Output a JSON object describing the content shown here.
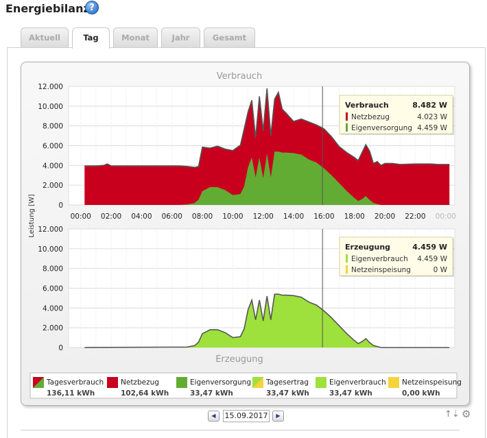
{
  "header": {
    "title": "Energiebilanz",
    "help_icon": "question-mark-icon",
    "help_label": "?"
  },
  "tabs": [
    {
      "label": "Aktuell",
      "active": false
    },
    {
      "label": "Tag",
      "active": true
    },
    {
      "label": "Monat",
      "active": false
    },
    {
      "label": "Jahr",
      "active": false
    },
    {
      "label": "Gesamt",
      "active": false
    }
  ],
  "colors": {
    "netzbezug": "#c8001e",
    "eigenversorgung": "#62ac34",
    "eigenverbrauch": "#9ee03c",
    "netzeinspeisung": "#f5d33a"
  },
  "chart_data": [
    {
      "type": "area",
      "title": "Verbrauch",
      "ylabel": "Leistung [W]",
      "ylim": [
        0,
        12000
      ],
      "yticks": [
        "0",
        "2.000",
        "4.000",
        "6.000",
        "8.000",
        "10.000",
        "12.000"
      ],
      "xlim": [
        0,
        24
      ],
      "xticks": [
        "00:00",
        "02:00",
        "04:00",
        "06:00",
        "08:00",
        "10:00",
        "12:00",
        "14:00",
        "16:00",
        "18:00",
        "20:00",
        "22:00",
        "00:00"
      ],
      "grid": true,
      "x": [
        0.25,
        1,
        1.5,
        1.75,
        2,
        3,
        4,
        5,
        6,
        6.5,
        7,
        7.5,
        7.75,
        8,
        8.5,
        9,
        9.5,
        10,
        10.5,
        10.75,
        11,
        11.25,
        11.5,
        11.75,
        12,
        12.25,
        12.5,
        12.75,
        13,
        13.25,
        13.5,
        14,
        14.5,
        15,
        15.5,
        16,
        16.5,
        17,
        17.5,
        18,
        18.25,
        18.5,
        18.75,
        19,
        19.25,
        19.5,
        19.75,
        20,
        20.5,
        21,
        22,
        23,
        23.5,
        24.25
      ],
      "series": [
        {
          "name": "Netzbezug",
          "stack": "load",
          "values": [
            3950,
            3950,
            4000,
            4150,
            3950,
            3950,
            3950,
            3950,
            3950,
            3950,
            3850,
            3600,
            3350,
            4450,
            3950,
            4150,
            4150,
            4500,
            4950,
            5800,
            5600,
            5800,
            4000,
            6200,
            4800,
            6600,
            4200,
            5300,
            6000,
            4400,
            4000,
            3200,
            3600,
            3800,
            3800,
            4000,
            3900,
            3700,
            3900,
            4100,
            4100,
            4700,
            5200,
            4950,
            4000,
            4300,
            4000,
            4200,
            4200,
            4100,
            4150,
            4150,
            4100,
            4100
          ]
        },
        {
          "name": "Eigenversorgung",
          "stack": "load",
          "values": [
            0,
            0,
            0,
            0,
            0,
            0,
            0,
            0,
            0,
            0,
            50,
            200,
            550,
            1400,
            1800,
            1800,
            1500,
            1000,
            1100,
            1900,
            3800,
            4800,
            2800,
            4800,
            2700,
            5200,
            2800,
            5400,
            5400,
            5300,
            5300,
            5250,
            5100,
            4600,
            4300,
            3700,
            3000,
            2200,
            1400,
            700,
            400,
            600,
            900,
            500,
            200,
            100,
            0,
            0,
            0,
            0,
            0,
            0,
            0,
            0
          ]
        }
      ],
      "tooltip": {
        "time": 15.9,
        "title": "Verbrauch",
        "total": "8.482 W",
        "rows": [
          {
            "label": "Netzbezug",
            "value": "4.023 W"
          },
          {
            "label": "Eigenversorgung",
            "value": "4.459 W"
          }
        ]
      }
    },
    {
      "type": "area",
      "title": "Erzeugung",
      "ylabel": "Leistung [W]",
      "ylim": [
        0,
        12000
      ],
      "yticks": [
        "0",
        "2.000",
        "4.000",
        "6.000",
        "8.000",
        "10.000",
        "12.000"
      ],
      "xlim": [
        0,
        24
      ],
      "grid": true,
      "x": [
        0.25,
        7,
        7.5,
        7.75,
        8,
        8.5,
        9,
        9.5,
        10,
        10.5,
        10.75,
        11,
        11.25,
        11.5,
        11.75,
        12,
        12.25,
        12.5,
        12.75,
        13,
        13.25,
        13.5,
        14,
        14.5,
        15,
        15.5,
        16,
        16.5,
        17,
        17.5,
        18,
        18.25,
        18.5,
        18.75,
        19,
        19.25,
        19.5,
        19.75,
        20,
        24.25
      ],
      "series": [
        {
          "name": "Eigenverbrauch",
          "values": [
            0,
            50,
            200,
            550,
            1400,
            1800,
            1800,
            1500,
            1000,
            1100,
            1900,
            3800,
            4800,
            2800,
            4800,
            2700,
            5200,
            2800,
            5400,
            5400,
            5300,
            5300,
            5250,
            5100,
            4600,
            4300,
            3700,
            3000,
            2200,
            1400,
            700,
            400,
            600,
            900,
            500,
            200,
            100,
            0,
            0,
            0
          ]
        },
        {
          "name": "Netzeinspeisung",
          "values": [
            0,
            0,
            0,
            0,
            0,
            0,
            0,
            0,
            0,
            0,
            0,
            0,
            0,
            0,
            0,
            0,
            0,
            0,
            0,
            0,
            0,
            0,
            0,
            0,
            0,
            0,
            0,
            0,
            0,
            0,
            0,
            0,
            0,
            0,
            0,
            0,
            0,
            0,
            0,
            0
          ]
        }
      ],
      "tooltip": {
        "time": 15.9,
        "title": "Erzeugung",
        "total": "4.459 W",
        "rows": [
          {
            "label": "Eigenverbrauch",
            "value": "4.459 W"
          },
          {
            "label": "Netzeinspeisung",
            "value": "0 W"
          }
        ]
      }
    }
  ],
  "legend": [
    {
      "label": "Tagesverbrauch",
      "value": "136,11 kWh",
      "color": "#c8001e",
      "color2": "#62ac34"
    },
    {
      "label": "Netzbezug",
      "value": "102,64 kWh",
      "color": "#c8001e"
    },
    {
      "label": "Eigenversorgung",
      "value": "33,47 kWh",
      "color": "#62ac34"
    },
    {
      "label": "Tagesertrag",
      "value": "33,47 kWh",
      "color": "#9ee03c",
      "color2": "#f5d33a"
    },
    {
      "label": "Eigenverbrauch",
      "value": "33,47 kWh",
      "color": "#9ee03c"
    },
    {
      "label": "Netzeinspeisung",
      "value": "0,00 kWh",
      "color": "#f5d33a"
    }
  ],
  "datebar": {
    "date": "15.09.2017",
    "prev_icon": "arrow-left-icon",
    "prev_label": "◀",
    "next_icon": "arrow-right-icon",
    "next_label": "▶"
  },
  "corner": {
    "icon": "sort-icon",
    "label": "↑⇣",
    "gear_icon": "gear-icon",
    "gear_label": "⚙"
  }
}
